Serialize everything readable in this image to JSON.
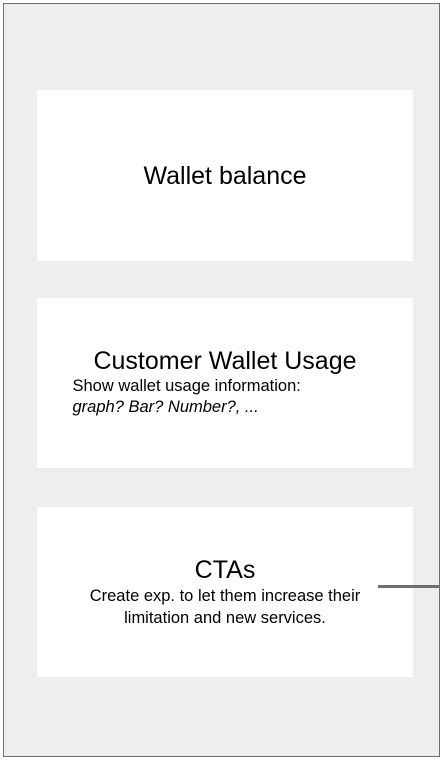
{
  "cards": {
    "balance": {
      "title": "Wallet balance"
    },
    "usage": {
      "title": "Customer Wallet Usage",
      "description": "Show wallet usage information:",
      "options": "graph? Bar? Number?, ..."
    },
    "cta": {
      "title": "CTAs",
      "description": "Create exp. to let them increase their limitation and new services."
    }
  },
  "colors": {
    "frame_background": "#eeeeee",
    "frame_border": "#6f6f6f",
    "card_background": "#ffffff",
    "connector": "#6f6f6f"
  }
}
